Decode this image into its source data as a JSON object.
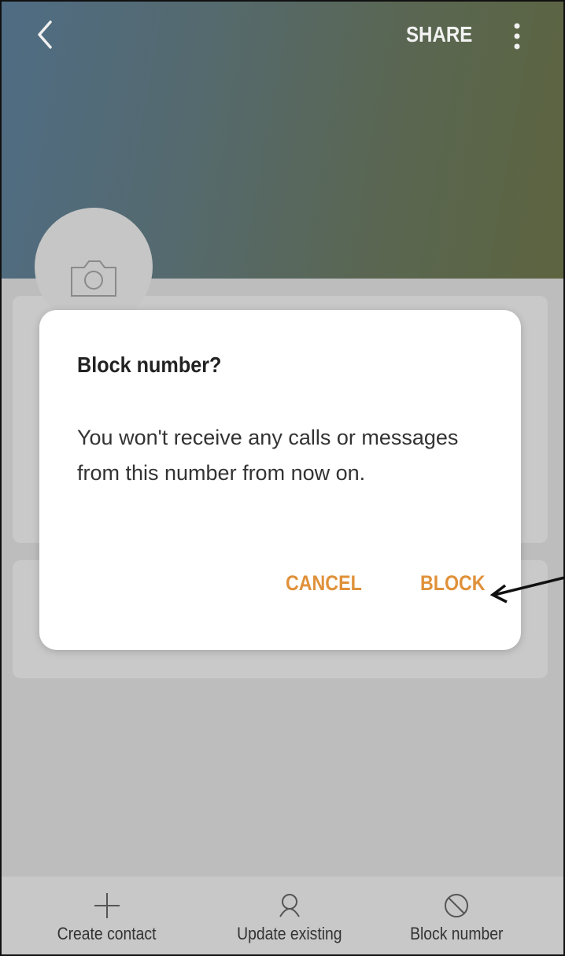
{
  "header": {
    "back_icon": "chevron-left-icon",
    "share_label": "SHARE",
    "more_icon": "more-vertical-icon"
  },
  "avatar": {
    "icon": "camera-icon"
  },
  "dialog": {
    "title": "Block number?",
    "message": "You won't receive any calls or messages from this number from now on.",
    "cancel_label": "CANCEL",
    "block_label": "BLOCK",
    "accent_color": "#e0913a"
  },
  "bottom_bar": {
    "items": [
      {
        "label": "Create contact",
        "icon": "plus-icon"
      },
      {
        "label": "Update existing",
        "icon": "person-icon"
      },
      {
        "label": "Block number",
        "icon": "block-icon"
      }
    ]
  }
}
